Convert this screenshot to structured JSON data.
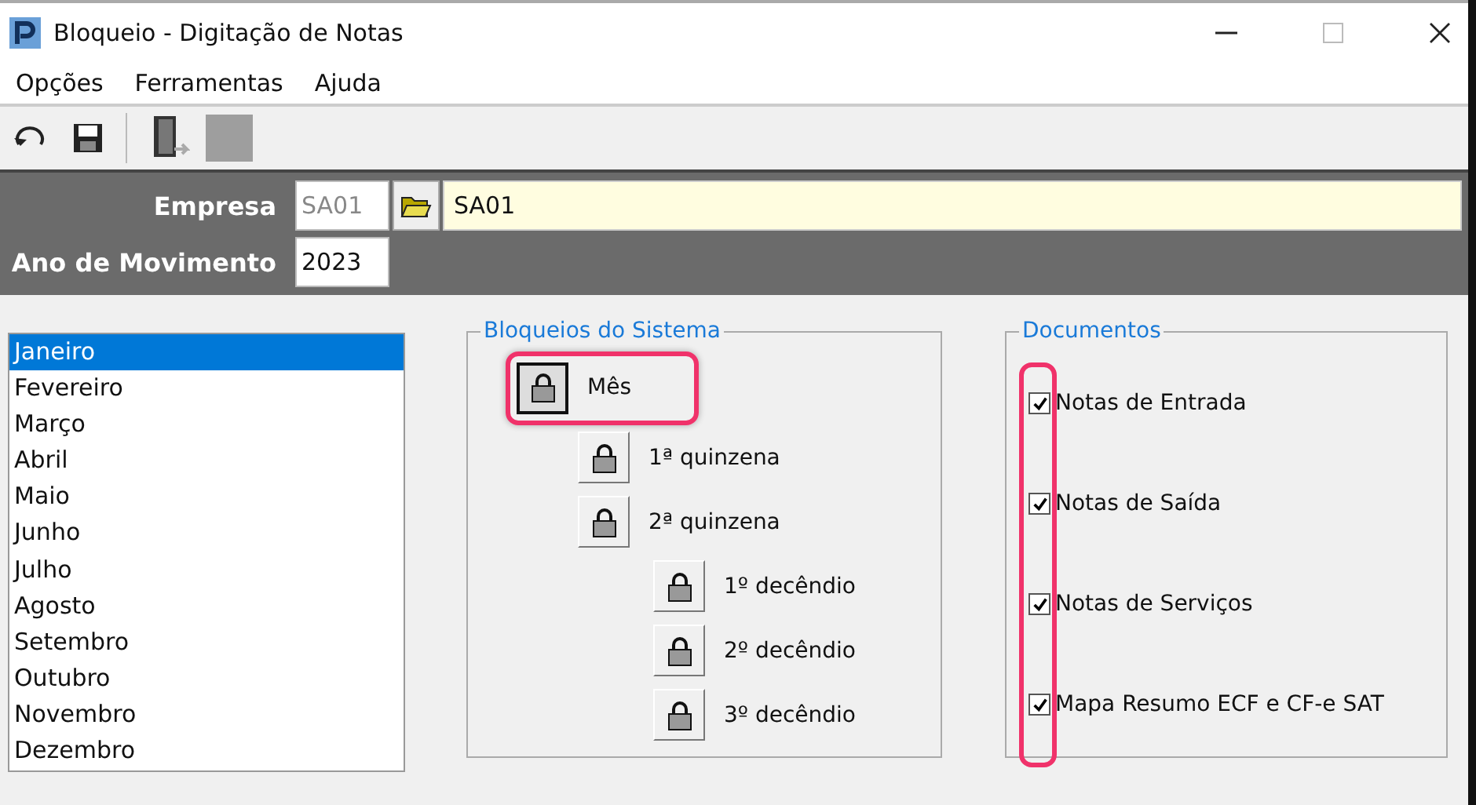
{
  "window": {
    "title": "Bloqueio - Digitação de Notas"
  },
  "menu": [
    "Opções",
    "Ferramentas",
    "Ajuda"
  ],
  "header": {
    "empresa_label": "Empresa",
    "empresa_code": "SA01",
    "empresa_name": "SA01",
    "ano_label": "Ano de Movimento",
    "ano_value": "2023"
  },
  "months": [
    {
      "label": "Janeiro",
      "selected": true
    },
    {
      "label": "Fevereiro",
      "selected": false
    },
    {
      "label": "Março",
      "selected": false
    },
    {
      "label": "Abril",
      "selected": false
    },
    {
      "label": "Maio",
      "selected": false
    },
    {
      "label": "Junho",
      "selected": false
    },
    {
      "label": "Julho",
      "selected": false
    },
    {
      "label": "Agosto",
      "selected": false
    },
    {
      "label": "Setembro",
      "selected": false
    },
    {
      "label": "Outubro",
      "selected": false
    },
    {
      "label": "Novembro",
      "selected": false
    },
    {
      "label": "Dezembro",
      "selected": false
    }
  ],
  "bloqueios": {
    "title": "Bloqueios do Sistema",
    "items": [
      {
        "label": "Mês",
        "kind": "month",
        "pressed": true,
        "highlighted": true
      },
      {
        "label": "1ª quinzena",
        "kind": "fortnight",
        "pressed": false,
        "highlighted": false
      },
      {
        "label": "2ª quinzena",
        "kind": "fortnight",
        "pressed": false,
        "highlighted": false
      },
      {
        "label": "1º decêndio",
        "kind": "tenday",
        "pressed": false,
        "highlighted": false
      },
      {
        "label": "2º decêndio",
        "kind": "tenday",
        "pressed": false,
        "highlighted": false
      },
      {
        "label": "3º decêndio",
        "kind": "tenday",
        "pressed": false,
        "highlighted": false
      }
    ]
  },
  "documentos": {
    "title": "Documentos",
    "highlighted": true,
    "items": [
      {
        "label": "Notas de Entrada",
        "checked": true
      },
      {
        "label": "Notas de Saída",
        "checked": true
      },
      {
        "label": "Notas de Serviços",
        "checked": true
      },
      {
        "label": "Mapa Resumo ECF e CF-e SAT",
        "checked": true
      }
    ]
  }
}
